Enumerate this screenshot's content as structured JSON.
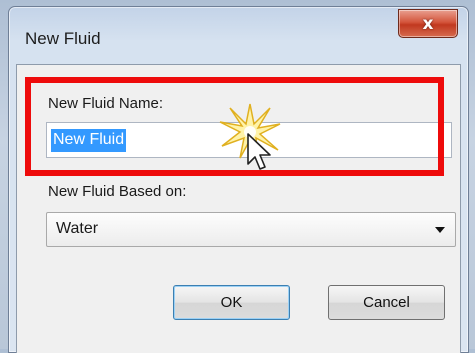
{
  "dialog": {
    "title": "New Fluid",
    "close_label": "x",
    "name_label": "New Fluid Name:",
    "name_value": "New Fluid",
    "based_on_label": "New Fluid Based on:",
    "based_on_value": "Water",
    "ok_label": "OK",
    "cancel_label": "Cancel"
  },
  "colors": {
    "highlight": "#ee0b0b",
    "selection": "#3399ff",
    "close_button": "#c1381f"
  },
  "icons": [
    "close-icon",
    "chevron-down-icon",
    "sparkle-icon",
    "mouse-cursor-icon"
  ]
}
